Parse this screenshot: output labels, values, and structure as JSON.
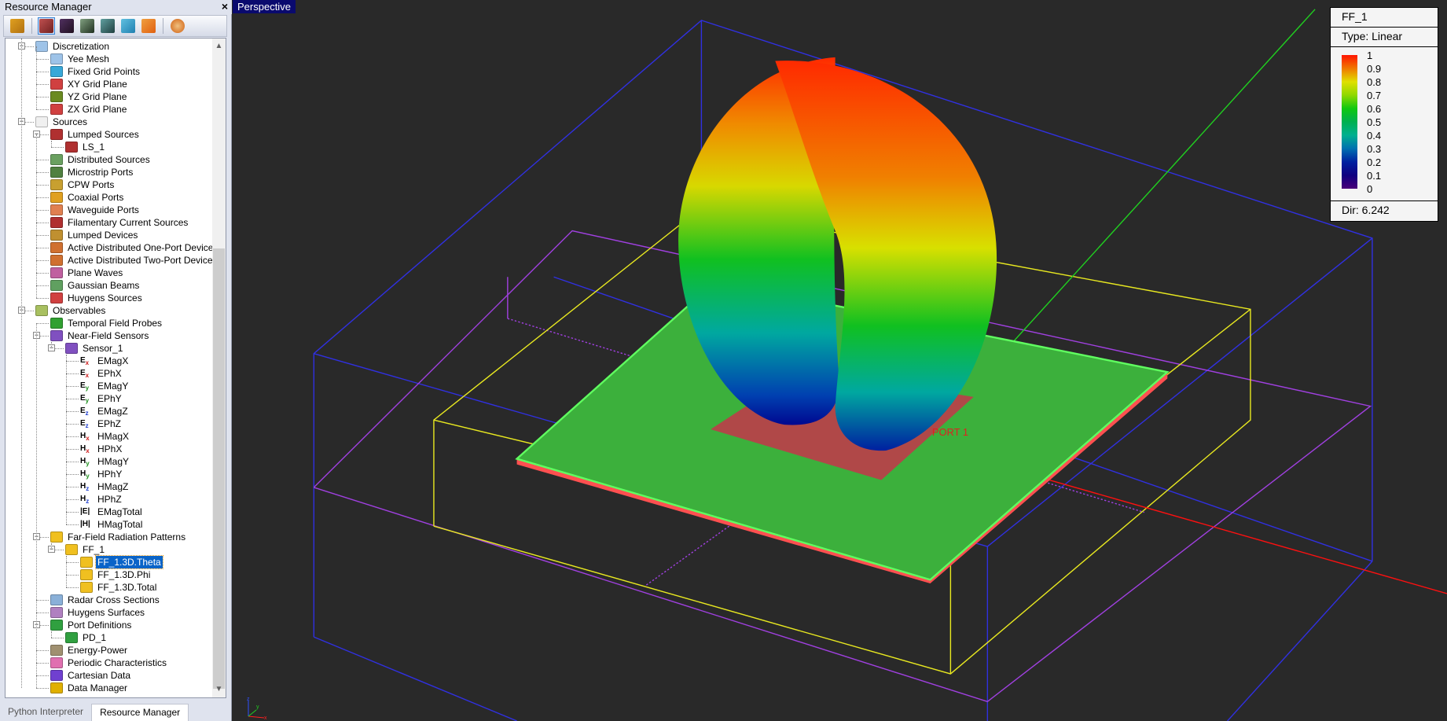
{
  "panel": {
    "title": "Resource Manager",
    "close": "×"
  },
  "toolbar": {
    "icons": [
      "geometry-icon",
      "materials-icon",
      "waveforms-icon",
      "params-icon",
      "groups-icon",
      "scripts-icon",
      "symmetry-icon",
      "array-icon"
    ]
  },
  "tree": [
    {
      "label": "Discretization",
      "level": 1,
      "exp": true,
      "icon": "grid-icon",
      "c": "#9ec3e8"
    },
    {
      "label": "Yee Mesh",
      "level": 2,
      "icon": "yee-mesh-icon",
      "c": "#9ec3e8"
    },
    {
      "label": "Fixed Grid Points",
      "level": 2,
      "icon": "fixed-grid-icon",
      "c": "#38a8d8"
    },
    {
      "label": "XY Grid Plane",
      "level": 2,
      "icon": "xy-plane-icon",
      "c": "#d04040"
    },
    {
      "label": "YZ Grid Plane",
      "level": 2,
      "icon": "yz-plane-icon",
      "c": "#6a8a20"
    },
    {
      "label": "ZX Grid Plane",
      "level": 2,
      "icon": "zx-plane-icon",
      "c": "#d04040"
    },
    {
      "label": "Sources",
      "level": 1,
      "exp": true,
      "icon": "sine-source-icon",
      "c": "#f0f0f0"
    },
    {
      "label": "Lumped Sources",
      "level": 2,
      "exp": true,
      "icon": "lumped-source-icon",
      "c": "#b03030"
    },
    {
      "label": "LS_1",
      "level": 3,
      "icon": "lumped-source-icon",
      "c": "#b03030"
    },
    {
      "label": "Distributed Sources",
      "level": 2,
      "icon": "distributed-source-icon",
      "c": "#6aa060"
    },
    {
      "label": "Microstrip Ports",
      "level": 2,
      "icon": "microstrip-port-icon",
      "c": "#508040"
    },
    {
      "label": "CPW Ports",
      "level": 2,
      "icon": "cpw-port-icon",
      "c": "#c8a030"
    },
    {
      "label": "Coaxial Ports",
      "level": 2,
      "icon": "coaxial-port-icon",
      "c": "#e0a020"
    },
    {
      "label": "Waveguide Ports",
      "level": 2,
      "icon": "waveguide-port-icon",
      "c": "#e08050"
    },
    {
      "label": "Filamentary Current Sources",
      "level": 2,
      "icon": "filament-source-icon",
      "c": "#b03030"
    },
    {
      "label": "Lumped Devices",
      "level": 2,
      "icon": "lumped-device-icon",
      "c": "#c09030"
    },
    {
      "label": "Active Distributed One-Port Devices",
      "level": 2,
      "icon": "one-port-icon",
      "c": "#d07030"
    },
    {
      "label": "Active Distributed Two-Port Devices",
      "level": 2,
      "icon": "two-port-icon",
      "c": "#d07030"
    },
    {
      "label": "Plane Waves",
      "level": 2,
      "icon": "plane-wave-icon",
      "c": "#c060a0"
    },
    {
      "label": "Gaussian Beams",
      "level": 2,
      "icon": "gaussian-beam-icon",
      "c": "#60a060"
    },
    {
      "label": "Huygens Sources",
      "level": 2,
      "icon": "huygens-source-icon",
      "c": "#d04040"
    },
    {
      "label": "Observables",
      "level": 1,
      "exp": true,
      "icon": "observables-icon",
      "c": "#a8c060"
    },
    {
      "label": "Temporal Field Probes",
      "level": 2,
      "icon": "probe-icon",
      "c": "#30a030"
    },
    {
      "label": "Near-Field Sensors",
      "level": 2,
      "exp": true,
      "icon": "sensor-icon",
      "c": "#8050c0"
    },
    {
      "label": "Sensor_1",
      "level": 3,
      "exp": true,
      "icon": "sensor-icon",
      "c": "#8050c0"
    },
    {
      "label": "EMagX",
      "level": 4,
      "icon": "ex-icon",
      "g": "E",
      "s": "x",
      "sc": "#d02020"
    },
    {
      "label": "EPhX",
      "level": 4,
      "icon": "ex-icon",
      "g": "E",
      "s": "x",
      "sc": "#d02020"
    },
    {
      "label": "EMagY",
      "level": 4,
      "icon": "ey-icon",
      "g": "E",
      "s": "y",
      "sc": "#209020"
    },
    {
      "label": "EPhY",
      "level": 4,
      "icon": "ey-icon",
      "g": "E",
      "s": "y",
      "sc": "#209020"
    },
    {
      "label": "EMagZ",
      "level": 4,
      "icon": "ez-icon",
      "g": "E",
      "s": "z",
      "sc": "#2040d0"
    },
    {
      "label": "EPhZ",
      "level": 4,
      "icon": "ez-icon",
      "g": "E",
      "s": "z",
      "sc": "#2040d0"
    },
    {
      "label": "HMagX",
      "level": 4,
      "icon": "hx-icon",
      "g": "H",
      "s": "x",
      "sc": "#d02020"
    },
    {
      "label": "HPhX",
      "level": 4,
      "icon": "hx-icon",
      "g": "H",
      "s": "x",
      "sc": "#d02020"
    },
    {
      "label": "HMagY",
      "level": 4,
      "icon": "hy-icon",
      "g": "H",
      "s": "y",
      "sc": "#209020"
    },
    {
      "label": "HPhY",
      "level": 4,
      "icon": "hy-icon",
      "g": "H",
      "s": "y",
      "sc": "#209020"
    },
    {
      "label": "HMagZ",
      "level": 4,
      "icon": "hz-icon",
      "g": "H",
      "s": "z",
      "sc": "#2040d0"
    },
    {
      "label": "HPhZ",
      "level": 4,
      "icon": "hz-icon",
      "g": "H",
      "s": "z",
      "sc": "#2040d0"
    },
    {
      "label": "EMagTotal",
      "level": 4,
      "icon": "e-total-icon",
      "g": "|E|"
    },
    {
      "label": "HMagTotal",
      "level": 4,
      "icon": "h-total-icon",
      "g": "|H|"
    },
    {
      "label": "Far-Field Radiation Patterns",
      "level": 2,
      "exp": true,
      "icon": "far-field-icon",
      "c": "#f0c020"
    },
    {
      "label": "FF_1",
      "level": 3,
      "exp": true,
      "icon": "far-field-icon",
      "c": "#f0c020"
    },
    {
      "label": "FF_1.3D.Theta",
      "level": 4,
      "icon": "far-field-icon",
      "c": "#f0c020",
      "selected": true
    },
    {
      "label": "FF_1.3D.Phi",
      "level": 4,
      "icon": "far-field-icon",
      "c": "#f0c020"
    },
    {
      "label": "FF_1.3D.Total",
      "level": 4,
      "icon": "far-field-icon",
      "c": "#f0c020"
    },
    {
      "label": "Radar Cross Sections",
      "level": 2,
      "icon": "radar-icon",
      "c": "#8ab0d8"
    },
    {
      "label": "Huygens Surfaces",
      "level": 2,
      "icon": "huygens-surface-icon",
      "c": "#b080c0"
    },
    {
      "label": "Port Definitions",
      "level": 2,
      "exp": true,
      "icon": "port-def-icon",
      "c": "#30a040"
    },
    {
      "label": "PD_1",
      "level": 3,
      "icon": "port-def-icon",
      "c": "#30a040"
    },
    {
      "label": "Energy-Power",
      "level": 2,
      "icon": "energy-icon",
      "c": "#a09070"
    },
    {
      "label": "Periodic Characteristics",
      "level": 2,
      "icon": "periodic-icon",
      "c": "#e070b0"
    },
    {
      "label": "Cartesian Data",
      "level": 2,
      "icon": "cartesian-icon",
      "c": "#7040d0"
    },
    {
      "label": "Data Manager",
      "level": 2,
      "icon": "data-manager-icon",
      "c": "#e0b000"
    }
  ],
  "tabs": [
    "Python Interpreter",
    "Resource Manager"
  ],
  "viewport": {
    "mode": "Perspective",
    "port_label": "PORT 1"
  },
  "legend": {
    "title": "FF_1",
    "type": "Type: Linear",
    "ticks": [
      "1",
      "0.9",
      "0.8",
      "0.7",
      "0.6",
      "0.5",
      "0.4",
      "0.3",
      "0.2",
      "0.1",
      "0"
    ],
    "dir": "Dir: 6.242"
  },
  "triad": {
    "x": "x",
    "y": "y",
    "z": "z"
  }
}
